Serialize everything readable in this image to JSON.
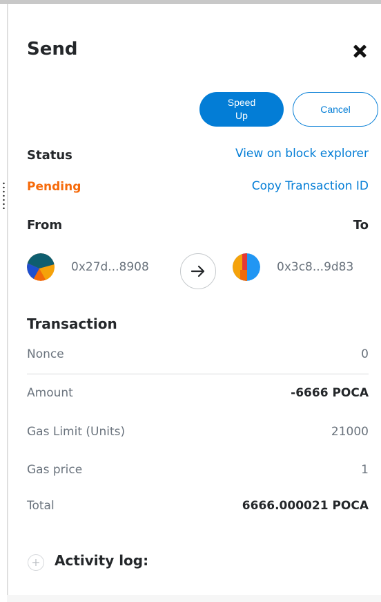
{
  "header": {
    "title": "Send"
  },
  "actions": {
    "speed_up_line1": "Speed",
    "speed_up_line2": "Up",
    "cancel": "Cancel"
  },
  "status": {
    "label": "Status",
    "value": "Pending",
    "value_color": "#f66a0a",
    "view_explorer": "View on block explorer",
    "copy_tx": "Copy Transaction ID"
  },
  "parties": {
    "from_label": "From",
    "to_label": "To",
    "from_address": "0x27d...8908",
    "to_address": "0x3c8...9d83"
  },
  "transaction": {
    "title": "Transaction",
    "rows": [
      {
        "label": "Nonce",
        "value": "0"
      },
      {
        "label": "Amount",
        "value": "-6666 POCA"
      },
      {
        "label": "Gas Limit (Units)",
        "value": "21000"
      },
      {
        "label": "Gas price",
        "value": "1"
      },
      {
        "label": "Total",
        "value": "6666.000021 POCA"
      }
    ]
  },
  "activity": {
    "label": "Activity log:"
  },
  "colors": {
    "accent": "#037dd6",
    "pending": "#f66a0a",
    "text": "#24272a",
    "muted": "#6a737d"
  },
  "icons": {
    "close": "close-icon",
    "arrow": "arrow-right-icon",
    "expand": "plus-circle-icon"
  }
}
